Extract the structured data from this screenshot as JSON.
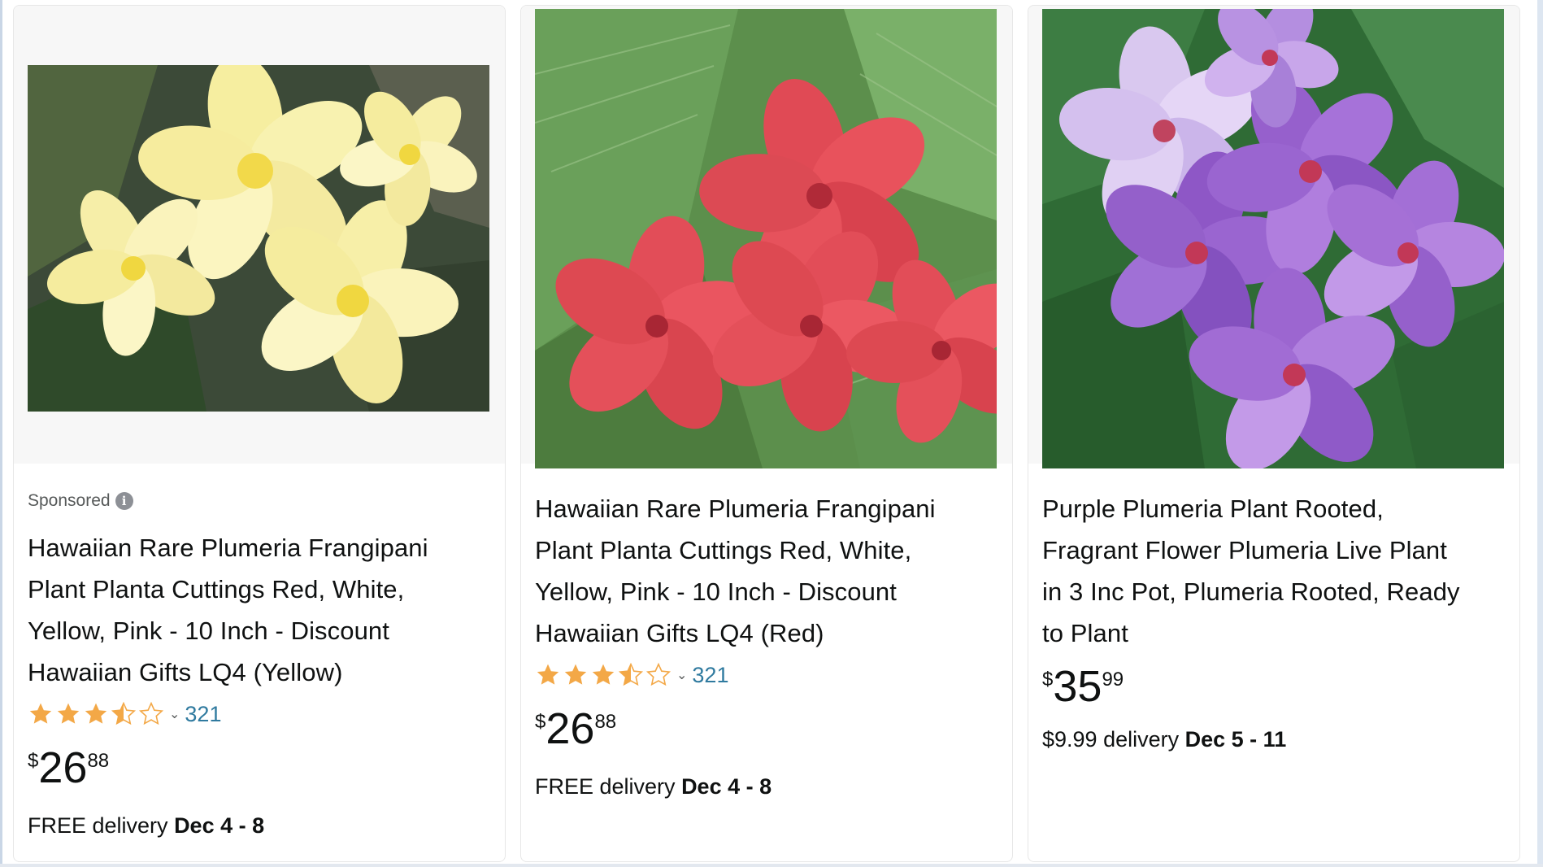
{
  "products": [
    {
      "sponsored_label": "Sponsored",
      "info_icon": "info-icon",
      "title_lines": [
        "Hawaiian Rare Plumeria Frangipani",
        "Plant Planta Cuttings Red, White,",
        "Yellow, Pink - 10 Inch - Discount",
        "Hawaiian Gifts LQ4 (Yellow)"
      ],
      "rating": 4,
      "rating_count": "321",
      "price_symbol": "$",
      "price_whole": "26",
      "price_fraction": "88",
      "delivery_prefix": "FREE delivery",
      "delivery_dates": "Dec 4 - 8",
      "image_icon": "yellow-plumeria-image"
    },
    {
      "title_lines": [
        "Hawaiian Rare Plumeria Frangipani",
        "Plant Planta Cuttings Red, White,",
        "Yellow, Pink - 10 Inch - Discount",
        "Hawaiian Gifts LQ4 (Red)"
      ],
      "rating": 4,
      "rating_count": "321",
      "price_symbol": "$",
      "price_whole": "26",
      "price_fraction": "88",
      "delivery_prefix": "FREE delivery",
      "delivery_dates": "Dec 4 - 8",
      "image_icon": "red-plumeria-image"
    },
    {
      "title_lines": [
        "Purple Plumeria Plant Rooted,",
        "Fragrant Flower Plumeria Live Plant",
        "in 3 Inc Pot, Plumeria Rooted, Ready",
        "to Plant"
      ],
      "price_symbol": "$",
      "price_whole": "35",
      "price_fraction": "99",
      "delivery_prefix": "$9.99 delivery",
      "delivery_dates": "Dec 5 - 11",
      "image_icon": "purple-plumeria-image"
    }
  ],
  "colors": {
    "star": "#f3a847",
    "rating_count": "#2f7a9f",
    "text": "#0f1111"
  }
}
